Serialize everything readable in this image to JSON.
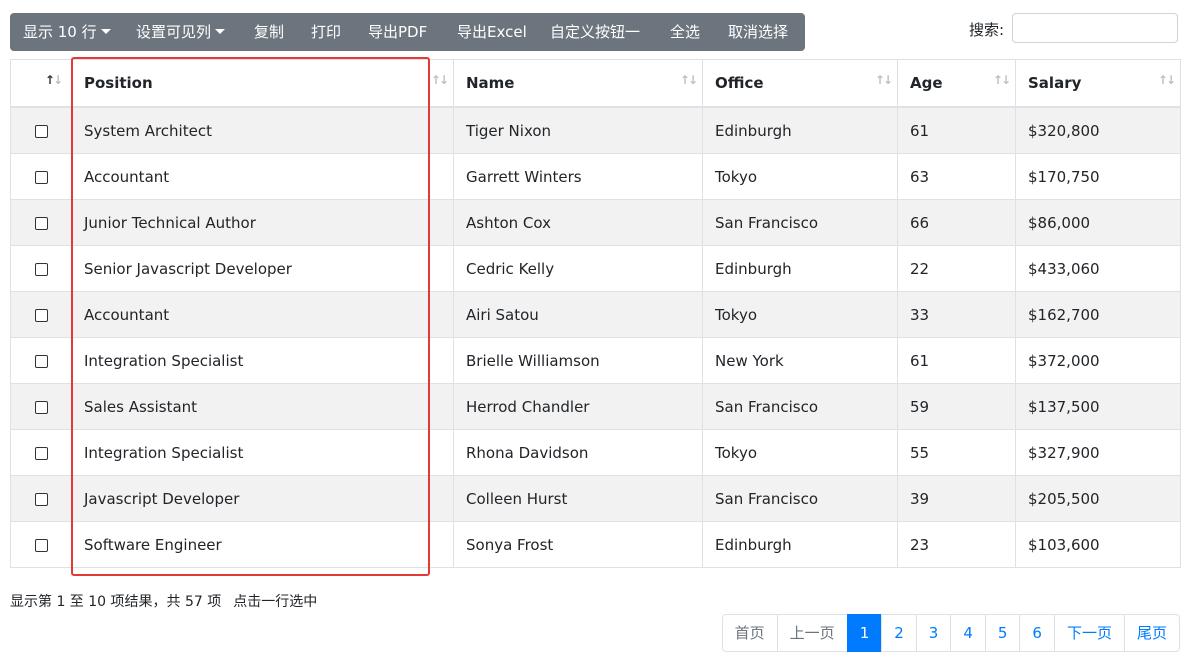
{
  "toolbar": {
    "show_rows": "显示 10 行",
    "column_visibility": "设置可见列",
    "copy": "复制",
    "print": "打印",
    "export_pdf": "导出PDF",
    "export_excel": "导出Excel",
    "custom_button": "自定义按钮一",
    "select_all": "全选",
    "deselect": "取消选择"
  },
  "search": {
    "label": "搜索:",
    "value": ""
  },
  "table": {
    "columns": [
      "Position",
      "Name",
      "Office",
      "Age",
      "Salary"
    ],
    "rows": [
      [
        "System Architect",
        "Tiger Nixon",
        "Edinburgh",
        "61",
        "$320,800"
      ],
      [
        "Accountant",
        "Garrett Winters",
        "Tokyo",
        "63",
        "$170,750"
      ],
      [
        "Junior Technical Author",
        "Ashton Cox",
        "San Francisco",
        "66",
        "$86,000"
      ],
      [
        "Senior Javascript Developer",
        "Cedric Kelly",
        "Edinburgh",
        "22",
        "$433,060"
      ],
      [
        "Accountant",
        "Airi Satou",
        "Tokyo",
        "33",
        "$162,700"
      ],
      [
        "Integration Specialist",
        "Brielle Williamson",
        "New York",
        "61",
        "$372,000"
      ],
      [
        "Sales Assistant",
        "Herrod Chandler",
        "San Francisco",
        "59",
        "$137,500"
      ],
      [
        "Integration Specialist",
        "Rhona Davidson",
        "Tokyo",
        "55",
        "$327,900"
      ],
      [
        "Javascript Developer",
        "Colleen Hurst",
        "San Francisco",
        "39",
        "$205,500"
      ],
      [
        "Software Engineer",
        "Sonya Frost",
        "Edinburgh",
        "23",
        "$103,600"
      ]
    ]
  },
  "footer": {
    "info": "显示第 1 至 10 项结果，共 57 项",
    "selection": "点击一行选中"
  },
  "pagination": {
    "first": "首页",
    "prev": "上一页",
    "pages": [
      "1",
      "2",
      "3",
      "4",
      "5",
      "6"
    ],
    "next": "下一页",
    "last": "尾页"
  },
  "colors": {
    "accent": "#007bff",
    "toolbar": "#6c757d",
    "highlight": "#e53935"
  }
}
